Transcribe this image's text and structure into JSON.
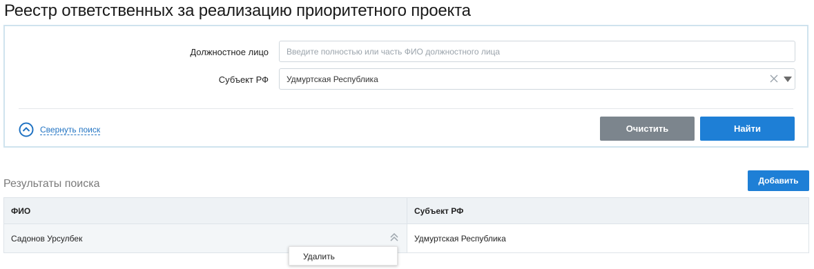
{
  "page": {
    "title": "Реестр ответственных за реализацию приоритетного проекта"
  },
  "search": {
    "official_label": "Должностное лицо",
    "official_placeholder": "Введите полностью или часть ФИО должностного лица",
    "official_value": "",
    "subject_label": "Субъект РФ",
    "subject_value": "Удмуртская Республика",
    "collapse_label": "Свернуть поиск",
    "clear_label": "Очистить",
    "find_label": "Найти"
  },
  "results": {
    "title": "Результаты поиска",
    "add_label": "Добавить",
    "columns": [
      "ФИО",
      "Субъект РФ"
    ],
    "rows": [
      {
        "fio": "Садонов Урсулбек",
        "subject": "Удмуртская Республика"
      }
    ]
  },
  "context_menu": {
    "items": [
      "Удалить"
    ]
  },
  "colors": {
    "accent": "#1e7fd6",
    "secondary_button": "#7c858d",
    "panel_border": "#cfe3ee",
    "link": "#1f72c2"
  },
  "icons": {
    "clear": "close-icon",
    "dropdown": "caret-down-icon",
    "collapse": "chevron-up-circle-icon",
    "row_menu": "double-chevron-up-icon"
  }
}
